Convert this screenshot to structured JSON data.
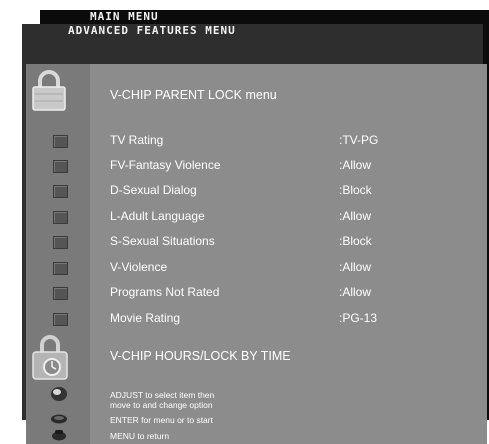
{
  "main_menu": {
    "title": "MAIN MENU"
  },
  "advanced_menu": {
    "title": "ADVANCED FEATURES MENU"
  },
  "vchip": {
    "heading": "V-CHIP PARENT LOCK menu",
    "items": [
      {
        "label": "TV Rating",
        "value": ":TV-PG"
      },
      {
        "label": "FV-Fantasy Violence",
        "value": ":Allow"
      },
      {
        "label": "D-Sexual Dialog",
        "value": ":Block"
      },
      {
        "label": "L-Adult Language",
        "value": ":Allow"
      },
      {
        "label": "S-Sexual Situations",
        "value": ":Block"
      },
      {
        "label": "V-Violence",
        "value": ":Allow"
      },
      {
        "label": "Programs Not Rated",
        "value": ":Allow"
      },
      {
        "label": "Movie Rating",
        "value": ":PG-13"
      }
    ]
  },
  "hours_lock": {
    "heading": "V-CHIP HOURS/LOCK BY TIME"
  },
  "help": {
    "adjust_line1": "ADJUST to select item then",
    "adjust_line2": "move to and change option",
    "enter": "ENTER for menu or to start",
    "menu": "MENU to return"
  },
  "icons": {
    "parent_lock": "padlock-icon",
    "time_lock": "padlock-clock-icon",
    "adjust": "dial-icon",
    "enter": "enter-button-icon",
    "menu": "menu-button-icon"
  }
}
